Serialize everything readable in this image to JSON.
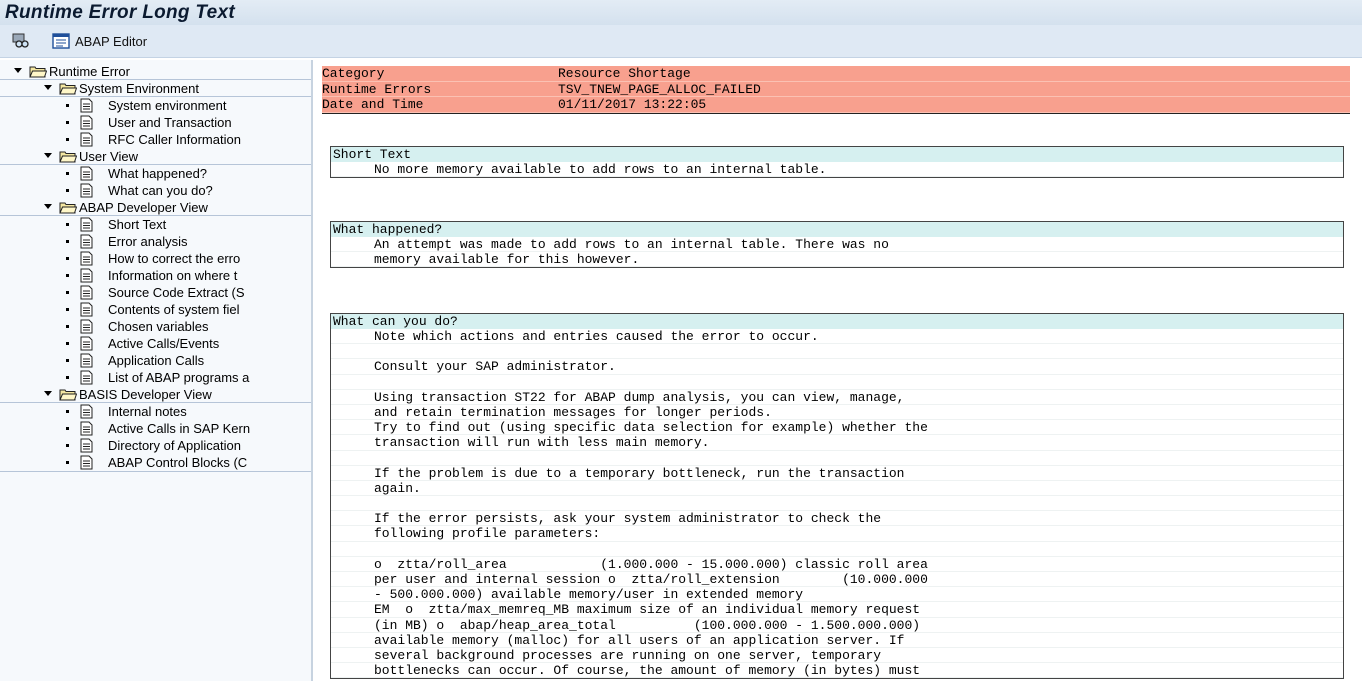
{
  "window": {
    "title": "Runtime Error Long Text"
  },
  "toolbar": {
    "glasses_icon": "display-object-icon",
    "editor_icon": "abap-editor-icon",
    "editor_label": "ABAP Editor"
  },
  "tree": {
    "root": {
      "label": "Runtime Error"
    },
    "groups": [
      {
        "label": "System Environment",
        "items": [
          "System environment",
          "User and Transaction",
          "RFC Caller Information"
        ]
      },
      {
        "label": "User View",
        "items": [
          "What happened?",
          "What can you do?"
        ]
      },
      {
        "label": "ABAP Developer View",
        "items": [
          "Short Text",
          "Error analysis",
          "How to correct the erro",
          "Information on where t",
          "Source Code Extract (S",
          "Contents of system fiel",
          "Chosen variables",
          "Active Calls/Events",
          "Application Calls",
          "List of ABAP programs a"
        ]
      },
      {
        "label": "BASIS Developer View",
        "items": [
          "Internal notes",
          "Active Calls in SAP Kern",
          "Directory of Application",
          "ABAP Control Blocks (C"
        ]
      }
    ]
  },
  "header": {
    "rows": [
      {
        "key": "Category",
        "value": "Resource Shortage"
      },
      {
        "key": "Runtime Errors",
        "value": "TSV_TNEW_PAGE_ALLOC_FAILED"
      },
      {
        "key": "Date and Time",
        "value": "01/11/2017 13:22:05"
      }
    ],
    "highlight_color": "#f8a08e"
  },
  "sections": {
    "short_text": {
      "title": "Short Text",
      "lines": [
        "No more memory available to add rows to an internal table."
      ]
    },
    "what_happened": {
      "title": "What happened?",
      "lines": [
        "An attempt was made to add rows to an internal table. There was no",
        "memory available for this however."
      ]
    },
    "what_can_you_do": {
      "title": "What can you do?",
      "lines": [
        "Note which actions and entries caused the error to occur.",
        "",
        "Consult your SAP administrator.",
        "",
        "Using transaction ST22 for ABAP dump analysis, you can view, manage,",
        "and retain termination messages for longer periods.",
        "Try to find out (using specific data selection for example) whether the",
        "transaction will run with less main memory.",
        "",
        "If the problem is due to a temporary bottleneck, run the transaction",
        "again.",
        "",
        "If the error persists, ask your system administrator to check the",
        "following profile parameters:",
        "",
        "o  ztta/roll_area            (1.000.000 - 15.000.000) classic roll area",
        "per user and internal session o  ztta/roll_extension        (10.000.000",
        "- 500.000.000) available memory/user in extended memory",
        "EM  o  ztta/max_memreq_MB maximum size of an individual memory request",
        "(in MB) o  abap/heap_area_total          (100.000.000 - 1.500.000.000)",
        "available memory (malloc) for all users of an application server. If",
        "several background processes are running on one server, temporary",
        "bottlenecks can occur. Of course, the amount of memory (in bytes) must"
      ]
    },
    "title_bg": "#d6f0f0"
  }
}
